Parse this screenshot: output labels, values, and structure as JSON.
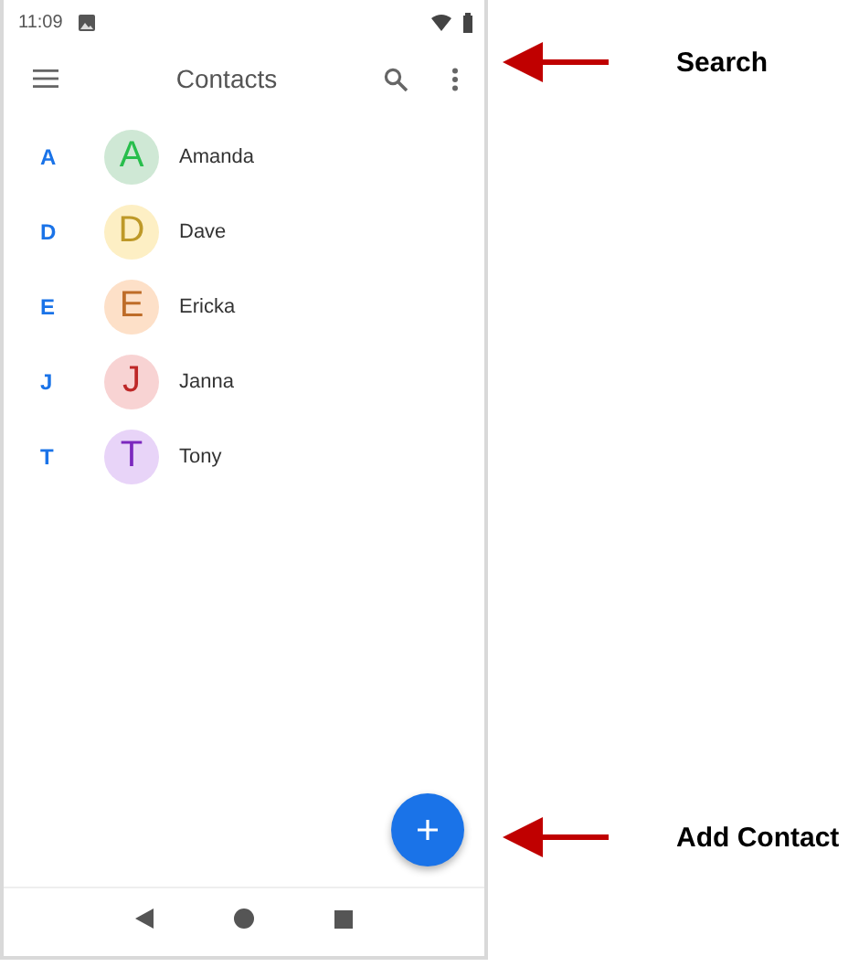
{
  "status_bar": {
    "time": "11:09"
  },
  "app_bar": {
    "title": "Contacts"
  },
  "contacts": [
    {
      "section": "A",
      "initial": "A",
      "name": "Amanda",
      "color": "#cfe8d5"
    },
    {
      "section": "D",
      "initial": "D",
      "name": "Dave",
      "color": "#fdefc4"
    },
    {
      "section": "E",
      "initial": "E",
      "name": "Ericka",
      "color": "#fde0c8"
    },
    {
      "section": "J",
      "initial": "J",
      "name": "Janna",
      "color": "#f8d3d3"
    },
    {
      "section": "T",
      "initial": "T",
      "name": "Tony",
      "color": "#e8d4f8"
    }
  ],
  "annotations": [
    {
      "label": "Search"
    },
    {
      "label": "Add Contact"
    }
  ]
}
